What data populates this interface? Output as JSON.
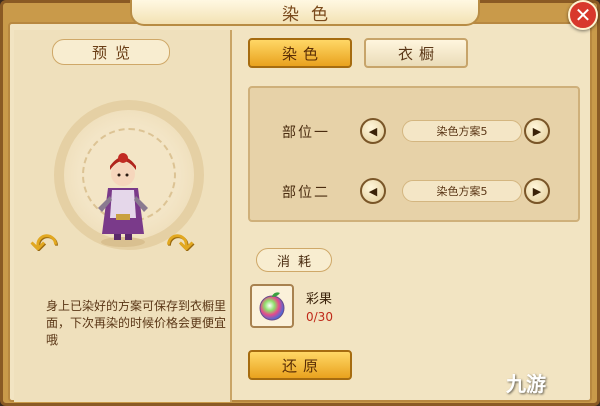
{
  "title": "染色",
  "close_icon": "close-icon",
  "preview": {
    "label": "预览",
    "hint": "身上已染好的方案可保存到衣橱里面，下次再染的时候价格会更便宜哦"
  },
  "tabs": {
    "dye": "染色",
    "wardrobe": "衣橱"
  },
  "parts": [
    {
      "label": "部位一",
      "scheme": "染色方案5"
    },
    {
      "label": "部位二",
      "scheme": "染色方案5"
    }
  ],
  "consume": {
    "label": "消耗",
    "item_name": "彩果",
    "item_count": "0/30"
  },
  "restore_label": "还原",
  "watermark": "九游",
  "colors": {
    "accent": "#e9a21e",
    "panel": "#f2e4c2",
    "count_red": "#c02a1a"
  }
}
